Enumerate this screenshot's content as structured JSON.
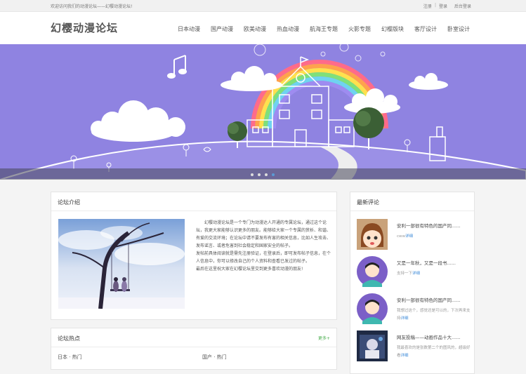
{
  "topbar": {
    "welcome": "欢迎访问我们的动漫论坛——幻樱动漫论坛!",
    "register": "注册",
    "separator": "|",
    "login": "登录",
    "admin_login": "后台登录"
  },
  "header": {
    "logo": "幻樱动漫论坛",
    "nav": [
      "日本动漫",
      "国产动漫",
      "欧美动漫",
      "热血动漫",
      "航海王专题",
      "火影专题",
      "幻樱版块",
      "客厅设计",
      "卧室设计"
    ]
  },
  "banner": {
    "slide_count": 4,
    "active_slide": 4
  },
  "intro": {
    "title": "论坛介绍",
    "paragraphs": [
      "幻樱动漫论坛是一个专门为动漫达人开通的专属论坛，通过这个论坛，我更大家能够认识更多的朋友。能够给大家一个专属的赏析、和谐、有爱的交流环境；在论坛中请不要发布有害的相关信息，比如人生攻击、发布谣言、或者危害到社会稳定和国家安全的帖子。",
      "发帖前具体阅读就是需先注册验证，在登录后，即可发布帖子信息，在个人信息中，你可以修改自己的个人资料和查看已发过的帖子。",
      "最后在这里祝大家在幻樱论坛里交到更多喜欢动漫的朋友!"
    ]
  },
  "hot": {
    "title": "论坛热点",
    "more": "更多+",
    "col1": "日本 · 热门",
    "col2": "国产 · 热门"
  },
  "comments": {
    "title": "最新评论",
    "items": [
      {
        "title": "安利一部很有特色的国产同......",
        "body": "cww",
        "link": "详细"
      },
      {
        "title": "又是一年秋，又是一段书......",
        "body": "支持一下",
        "link": "详细"
      },
      {
        "title": "安利一部很有特色的国产同......",
        "body": "我想过这个，感觉还是可以的，下次再来支持",
        "link": "详细"
      },
      {
        "title": "网友投稿——动画作品十大......",
        "body": "我最喜欢的是张数第二个的图风的，超级好看",
        "link": "详细"
      }
    ]
  },
  "colors": {
    "banner_bg": "#8f83e1",
    "link_blue": "#3c8ad8",
    "more_green": "#4caf50"
  }
}
